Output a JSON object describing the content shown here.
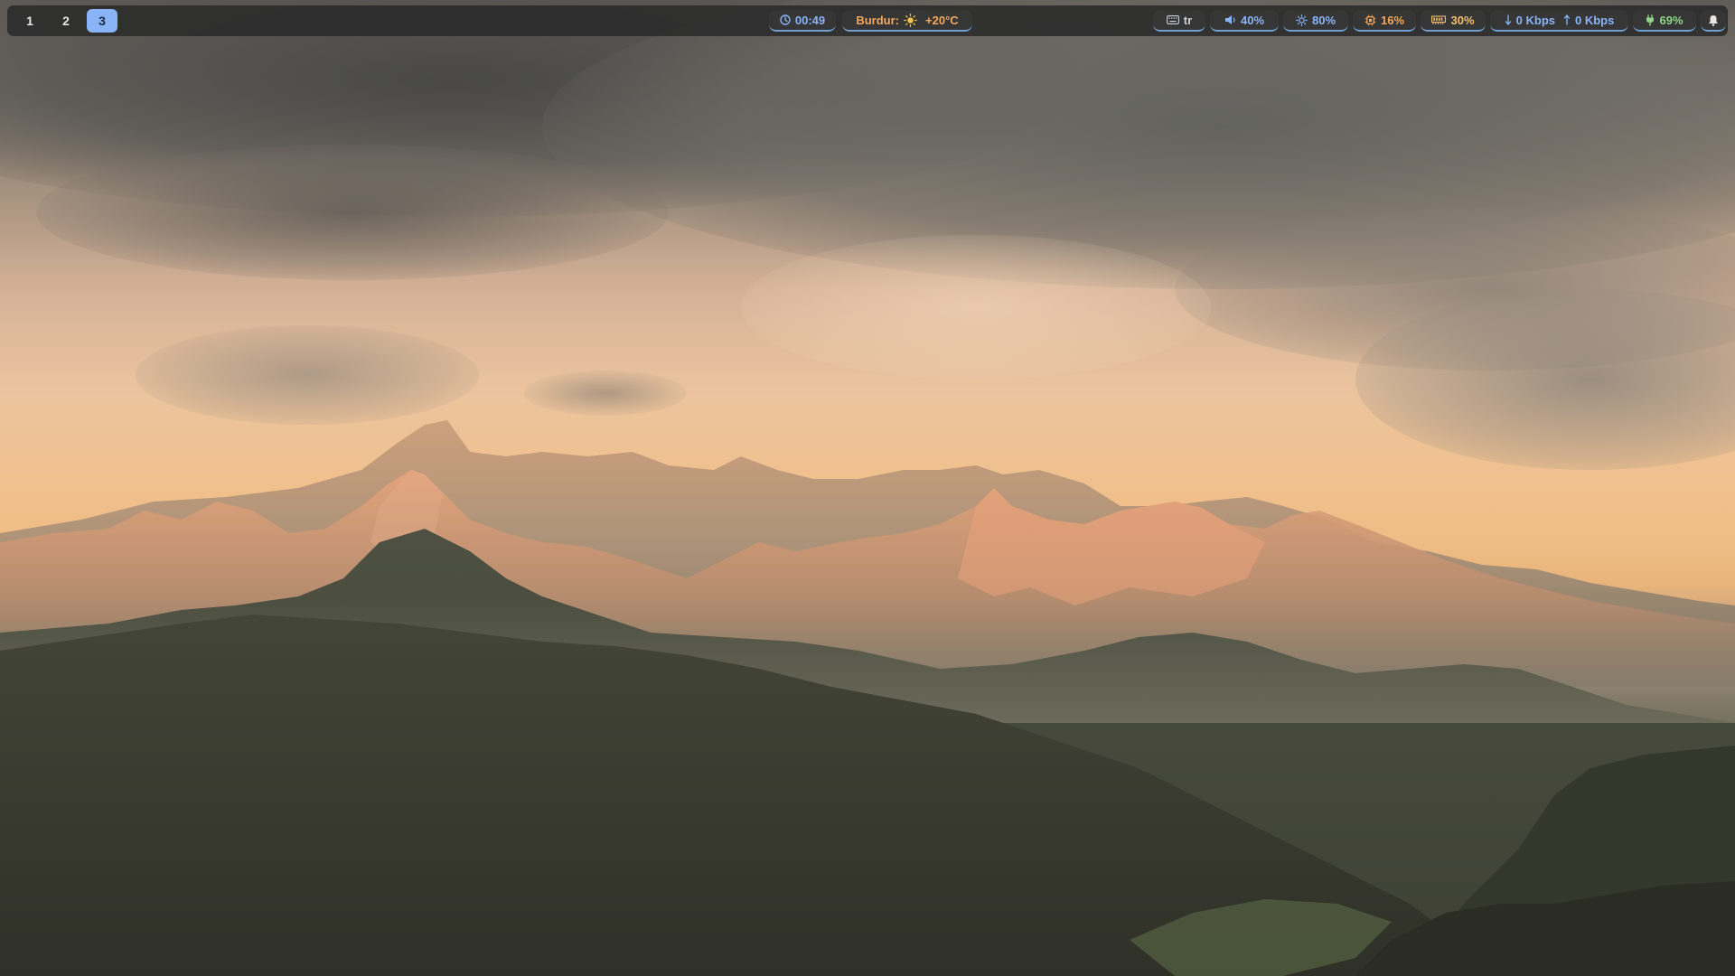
{
  "workspaces": [
    {
      "label": "1",
      "active": false
    },
    {
      "label": "2",
      "active": false
    },
    {
      "label": "3",
      "active": true
    }
  ],
  "clock": {
    "icon": "clock-icon",
    "time": "00:49"
  },
  "weather": {
    "city": "Burdur:",
    "icon": "sun-icon",
    "temp": "+20°C"
  },
  "keyboard": {
    "icon": "keyboard-icon",
    "layout": "tr"
  },
  "volume": {
    "icon": "speaker-icon",
    "value": "40%"
  },
  "brightness": {
    "icon": "brightness-icon",
    "value": "80%"
  },
  "cpu": {
    "icon": "cpu-icon",
    "value": "16%"
  },
  "memory": {
    "icon": "memory-icon",
    "value": "30%"
  },
  "network": {
    "down_icon": "arrow-down-icon",
    "down": "0 Kbps",
    "up_icon": "arrow-up-icon",
    "up": "0 Kbps"
  },
  "battery": {
    "icon": "charging-plug-icon",
    "value": "69%"
  },
  "notifications": {
    "icon": "bell-icon"
  },
  "colors": {
    "accent": "#8ab4f8",
    "warm": "#f0a860",
    "battery": "#8fd48a",
    "bar_bg": "#2c2c2c"
  }
}
